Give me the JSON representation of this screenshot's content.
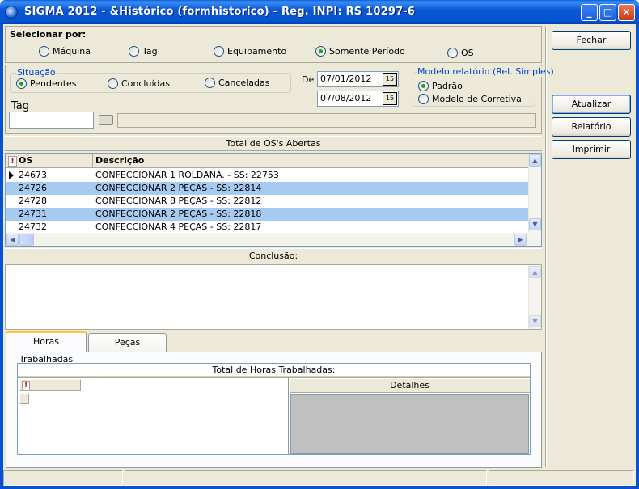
{
  "window": {
    "title": "SIGMA 2012 - &Histórico  (formhistorico)  - Reg. INPI: RS 10297-6",
    "minimize_glyph": "_",
    "maximize_glyph": "□",
    "close_glyph": "✕"
  },
  "selecionar": {
    "label": "Selecionar por:",
    "options": [
      "Máquina",
      "Tag",
      "Equipamento",
      "Somente Período",
      "OS"
    ],
    "selected": "Somente Período"
  },
  "situacao": {
    "title": "Situação",
    "options": [
      "Pendentes",
      "Concluídas",
      "Canceladas"
    ],
    "selected": "Pendentes"
  },
  "periodo": {
    "de_label": "De",
    "start_date": "07/01/2012",
    "end_date": "07/08/2012",
    "calendar_glyph": "15"
  },
  "modelo": {
    "title": "Modelo relatório (Rel. Simples)",
    "options": [
      "Padrão",
      "Modelo de Corretiva"
    ],
    "selected": "Padrão"
  },
  "tag": {
    "label": "Tag",
    "value": ""
  },
  "os_grid": {
    "header": "Total de OS's Abertas",
    "indicator_glyph": "!",
    "columns": [
      "OS",
      "Descrição"
    ],
    "rows": [
      {
        "os": "24673",
        "descricao": "CONFECCIONAR 1 ROLDANA. - SS: 22753",
        "selected": false,
        "current": true
      },
      {
        "os": "24726",
        "descricao": "CONFECCIONAR 2 PEÇAS - SS: 22814",
        "selected": true,
        "current": false
      },
      {
        "os": "24728",
        "descricao": "CONFECCIONAR 8 PEÇAS - SS: 22812",
        "selected": false,
        "current": false
      },
      {
        "os": "24731",
        "descricao": "CONFECCIONAR 2 PEÇAS - SS: 22818",
        "selected": true,
        "current": false
      },
      {
        "os": "24732",
        "descricao": "CONFECCIONAR 4 PEÇAS - SS: 22817",
        "selected": false,
        "current": false
      }
    ]
  },
  "conclusao": {
    "header": "Conclusão:",
    "text": ""
  },
  "tabs": {
    "items": [
      "Horas Trabalhadas",
      "Peças Consumidas"
    ],
    "active": "Horas Trabalhadas"
  },
  "horas": {
    "header": "Total de Horas Trabalhadas:",
    "detalhes_header": "Detalhes"
  },
  "buttons": {
    "fechar": "Fechar",
    "atualizar": "Atualizar",
    "relatorio_completo": "Relatório Completo",
    "imprimir": "Imprimir"
  },
  "colors": {
    "title_bar": "#0553cf",
    "selection": "#a6caf0",
    "group_title": "#0046d5",
    "form_bg": "#ece9d8"
  }
}
